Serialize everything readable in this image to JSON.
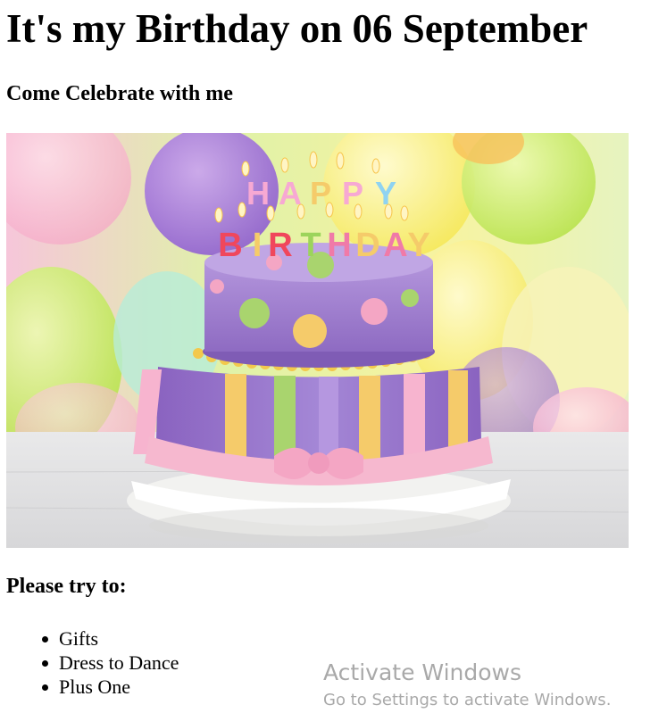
{
  "page": {
    "title": "It's my Birthday on 06 September",
    "subtitle": "Come Celebrate with me",
    "list_heading": "Please try to:",
    "list_items": [
      "Gifts",
      "Dress to Dance",
      "Plus One"
    ]
  },
  "image": {
    "subject": "birthday-cake-photo",
    "candle_text_line1": "HAPPY",
    "candle_text_line2": "BIRTHDAY"
  },
  "watermark": {
    "line1": "Activate Windows",
    "line2": "Go to Settings to activate Windows."
  }
}
